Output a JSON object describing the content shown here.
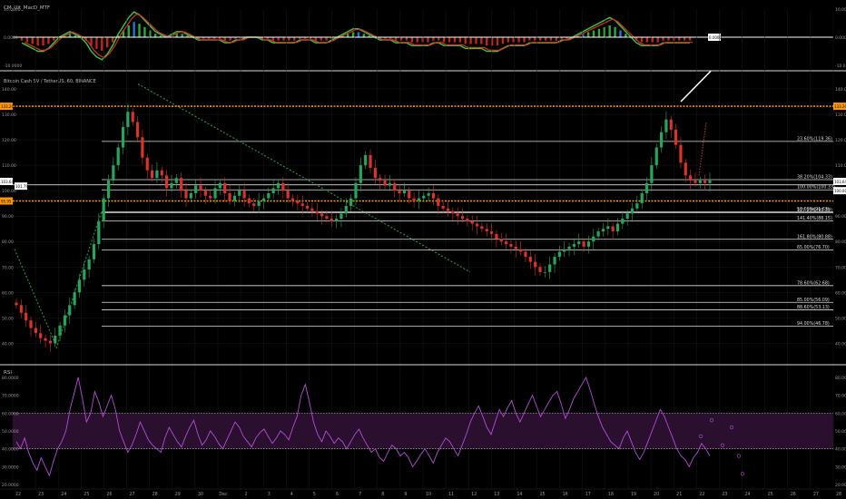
{
  "colors": {
    "background": "#000000",
    "grid": "#1a1a1a",
    "candle_up": "#26a65b",
    "candle_down": "#d9332b",
    "orange_level": "#ff9800",
    "fib_line": "#dcdcdc",
    "rsi": "#b14fd6",
    "rsi_band": "#2a0f2e",
    "trend_dashed": "#25a846",
    "macd_green": "#2ecc40",
    "macd_red": "#e0301e",
    "macd_blue": "#1e90ff",
    "axis_text": "#9a9a9a",
    "price_tag": "#ffffff"
  },
  "panels": {
    "macd_title": "CM_Ult_MacD_MTF",
    "main_title": "Bitcoin Cash SV / TetherUS, 60, BINANCE",
    "rsi_title": "RSI"
  },
  "chart_data": [
    {
      "type": "line",
      "title": "CM_Ult_MacD_MTF",
      "ylim": [
        -10,
        10
      ],
      "ticks_right": [
        "10.0000",
        "0.0000",
        "-10.0000"
      ],
      "ticks_left": [
        "10.0000",
        "0.0000",
        "-10.0000"
      ],
      "value_tag": "0.0000",
      "series": [
        {
          "x": [
            0,
            2,
            4,
            6,
            8,
            10,
            12,
            14,
            16,
            18,
            20,
            22,
            24,
            26,
            28,
            30,
            32,
            34,
            36,
            38,
            40,
            42,
            44,
            46,
            48,
            50,
            52,
            54,
            56,
            58,
            60,
            62,
            64,
            66,
            68,
            70,
            72,
            74,
            76,
            78,
            80,
            82,
            84,
            86,
            88,
            90,
            92,
            94,
            96,
            98,
            100,
            102,
            104,
            106,
            108,
            110,
            112,
            114,
            116,
            118,
            120,
            122,
            124,
            126,
            128,
            130,
            132,
            134,
            136,
            138,
            140,
            142,
            144,
            146,
            148,
            150,
            152,
            154,
            156,
            158,
            160,
            162,
            164,
            166,
            168,
            170,
            172,
            174,
            176,
            178,
            180,
            182,
            184,
            186,
            188,
            190,
            192,
            194,
            196,
            198,
            200,
            202,
            204,
            206,
            208,
            210,
            212,
            214,
            216,
            218,
            220,
            222,
            224,
            226,
            228,
            230,
            232,
            234,
            236,
            238,
            240,
            242,
            244,
            246,
            248,
            250
          ],
          "values": [
            -2,
            -3,
            -4,
            -5,
            -5,
            -4,
            -2,
            0,
            1,
            2,
            1,
            0,
            -2,
            -5,
            -7,
            -8,
            -6,
            -3,
            1,
            4,
            7,
            9,
            8,
            6,
            4,
            2,
            1,
            0,
            1,
            2,
            2,
            1,
            0,
            -1,
            -1,
            -1,
            -1,
            -1,
            -2,
            -2,
            -1,
            -1,
            0,
            0,
            0,
            -1,
            -1,
            -2,
            -2,
            -2,
            -2,
            -2,
            -1,
            -1,
            -1,
            -2,
            -2,
            -2,
            -1,
            0,
            1,
            2,
            3,
            3,
            2,
            1,
            0,
            -1,
            -1,
            -1,
            -2,
            -2,
            -2,
            -3,
            -3,
            -3,
            -3,
            -2,
            -2,
            -3,
            -3,
            -3,
            -3,
            -4,
            -4,
            -4,
            -4,
            -5,
            -5,
            -5,
            -4,
            -3,
            -3,
            -3,
            -3,
            -2,
            -2,
            -2,
            -2,
            -2,
            -2,
            -1,
            -1,
            0,
            1,
            2,
            3,
            4,
            5,
            6,
            7,
            6,
            4,
            2,
            0,
            -2,
            -3,
            -3,
            -3,
            -3,
            -2,
            -2,
            -2,
            -2,
            -2,
            -2
          ]
        }
      ]
    },
    {
      "type": "candlestick",
      "title": "Bitcoin Cash SV / TetherUS, 60, BINANCE",
      "ylim": [
        33,
        145
      ],
      "y_ticks": [
        "140.00",
        "130.00",
        "120.00",
        "110.00",
        "100.00",
        "90.00",
        "80.00",
        "70.00",
        "60.00",
        "50.00",
        "40.00"
      ],
      "x_tick_labels": [
        "22",
        "23",
        "24",
        "25",
        "26",
        "27",
        "28",
        "29",
        "30",
        "Dec",
        "2",
        "3",
        "4",
        "5",
        "6",
        "7",
        "8",
        "9",
        "10",
        "11",
        "12",
        "13",
        "14",
        "15",
        "16",
        "17",
        "18",
        "19",
        "20",
        "21",
        "22",
        "23",
        "24",
        "25",
        "26",
        "27",
        "28"
      ],
      "price_tags_left": [
        "133.20",
        "103.64",
        "101.79",
        "95.95"
      ],
      "price_tags_right": [
        "133.20",
        "103.64",
        "100.00"
      ],
      "orange_levels": [
        133.2,
        95.95
      ],
      "white_level": 102.3,
      "fib_levels": [
        {
          "label": "23.60%(119.36)",
          "value": 119.36
        },
        {
          "label": "38.20%(104.33)",
          "value": 104.33
        },
        {
          "label": "100.00%(100.33)",
          "value": 100.33
        },
        {
          "label": "50.00%(91.63)",
          "value": 91.63
        },
        {
          "label": "127.20%(91.39)",
          "value": 91.39
        },
        {
          "label": "141.40%(88.15)",
          "value": 88.15
        },
        {
          "label": "161.80%(80.88)",
          "value": 80.88
        },
        {
          "label": "65.00%(76.70)",
          "value": 76.7
        },
        {
          "label": "78.60%(62.68)",
          "value": 62.68
        },
        {
          "label": "85.00%(56.09)",
          "value": 56.09
        },
        {
          "label": "88.60%(53.13)",
          "value": 53.13
        },
        {
          "label": "94.00%(46.78)",
          "value": 46.78
        }
      ],
      "close": [
        55,
        52,
        49,
        46,
        44,
        42,
        41,
        40,
        43,
        47,
        51,
        55,
        60,
        65,
        69,
        73,
        79,
        88,
        97,
        104,
        110,
        117,
        125,
        131,
        127,
        121,
        113,
        108,
        105,
        108,
        106,
        101,
        103,
        105,
        100,
        97,
        99,
        102,
        100,
        98,
        97,
        101,
        103,
        99,
        96,
        98,
        100,
        97,
        95,
        94,
        96,
        97,
        99,
        101,
        103,
        100,
        97,
        96,
        95,
        94,
        93,
        92,
        91,
        90,
        89,
        88,
        89,
        91,
        94,
        97,
        103,
        110,
        114,
        109,
        105,
        104,
        102,
        103,
        100,
        99,
        100,
        97,
        96,
        97,
        98,
        99,
        97,
        94,
        93,
        92,
        91,
        90,
        89,
        88,
        87,
        86,
        85,
        84,
        83,
        81,
        80,
        79,
        78,
        77,
        76,
        74,
        72,
        70,
        68,
        68,
        71,
        74,
        76,
        77,
        78,
        79,
        80,
        78,
        80,
        82,
        84,
        85,
        86,
        84,
        87,
        89,
        91,
        93,
        95,
        99,
        103,
        110,
        117,
        123,
        128,
        124,
        118,
        111,
        106,
        104,
        103,
        104,
        103,
        104
      ]
    },
    {
      "type": "line",
      "title": "RSI",
      "ylim": [
        18,
        85
      ],
      "y_ticks": [
        "80.0000",
        "70.0000",
        "60.0000",
        "50.0000",
        "40.0000",
        "30.0000",
        "20.0000"
      ],
      "band": [
        40,
        60
      ],
      "series": [
        {
          "name": "RSI",
          "values": [
            44,
            40,
            46,
            38,
            32,
            28,
            35,
            30,
            25,
            33,
            40,
            44,
            50,
            62,
            71,
            80,
            68,
            55,
            60,
            72,
            66,
            58,
            64,
            70,
            62,
            50,
            44,
            38,
            42,
            48,
            55,
            50,
            45,
            42,
            40,
            38,
            46,
            52,
            48,
            44,
            41,
            47,
            52,
            56,
            48,
            42,
            45,
            50,
            47,
            43,
            40,
            45,
            50,
            55,
            52,
            47,
            44,
            41,
            46,
            49,
            51,
            47,
            43,
            46,
            50,
            48,
            45,
            52,
            58,
            70,
            76,
            66,
            55,
            48,
            44,
            50,
            47,
            43,
            46,
            44,
            40,
            44,
            48,
            51,
            46,
            42,
            38,
            40,
            35,
            33,
            38,
            42,
            40,
            36,
            38,
            35,
            30,
            33,
            37,
            40,
            36,
            32,
            38,
            42,
            46,
            44,
            40,
            36,
            42,
            48,
            55,
            60,
            64,
            58,
            52,
            48,
            55,
            62,
            58,
            63,
            67,
            60,
            55,
            60,
            65,
            70,
            64,
            58,
            62,
            66,
            70,
            72,
            65,
            57,
            62,
            68,
            72,
            76,
            80,
            73,
            65,
            58,
            52,
            48,
            44,
            42,
            40,
            46,
            50,
            44,
            38,
            34,
            38,
            44,
            50,
            56,
            62,
            58,
            52,
            46,
            40,
            36,
            34,
            30,
            35,
            38,
            43,
            40,
            36
          ]
        }
      ]
    }
  ]
}
